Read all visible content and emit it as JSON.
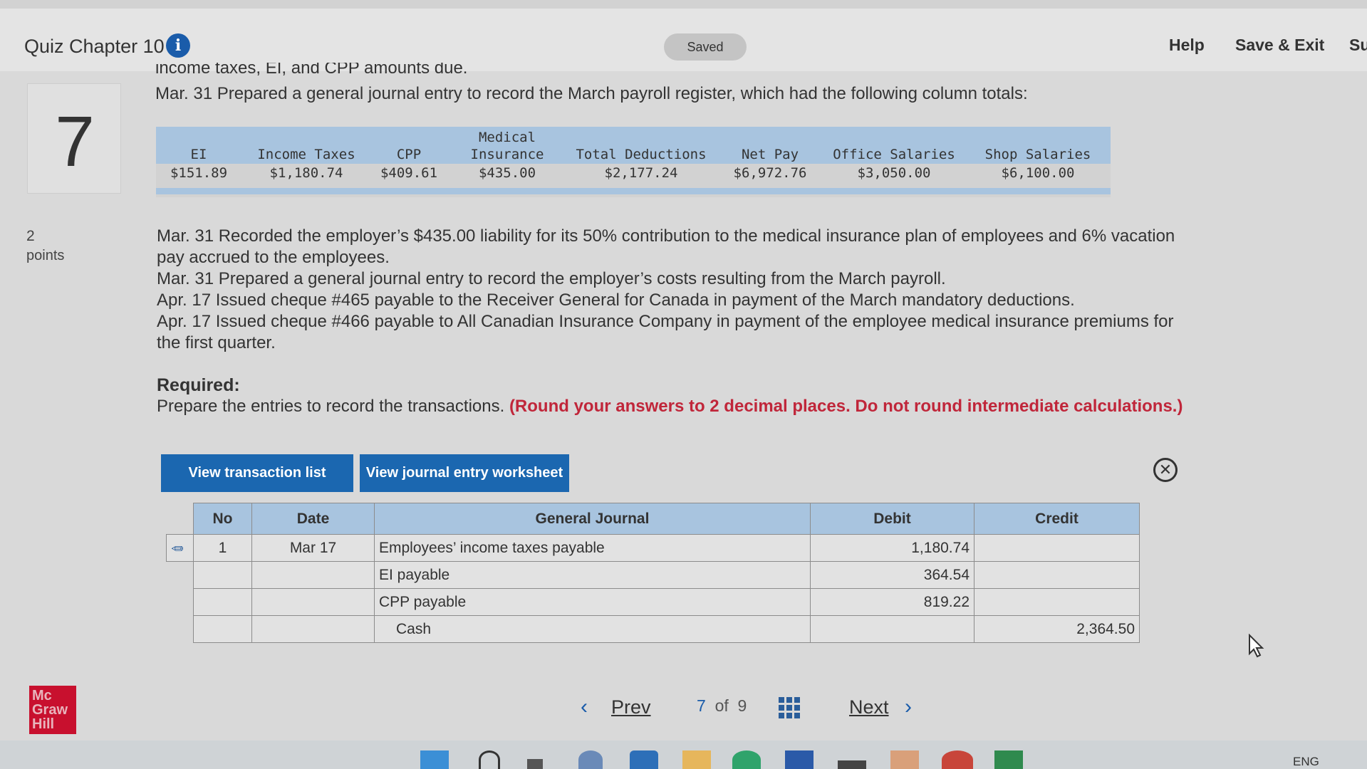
{
  "header": {
    "title": "Quiz Chapter 10",
    "status": "Saved",
    "help": "Help",
    "save_exit": "Save & Exit",
    "submit": "Su"
  },
  "question": {
    "number": "7",
    "points": "2",
    "points_label": "points",
    "cut_line": "income taxes, EI, and CPP amounts due.",
    "intro_line": "Mar. 31 Prepared a general journal entry to record the March payroll register, which had the following column totals:",
    "transactions": [
      "Mar. 31 Recorded the employer’s $435.00 liability for its 50% contribution to the medical insurance plan of employees and 6% vacation",
      "pay accrued to the employees.",
      "Mar. 31 Prepared a general journal entry to record the employer’s costs resulting from the March payroll.",
      "Apr. 17 Issued cheque #465 payable to the Receiver General for Canada in payment of the March mandatory deductions.",
      "Apr. 17 Issued cheque #466 payable to All Canadian Insurance Company in payment of the employee medical insurance premiums for",
      "the first quarter."
    ],
    "required_label": "Required:",
    "instruction": "Prepare the entries to record the transactions.",
    "instruction_red": "(Round your answers to 2 decimal places. Do not round intermediate calculations.)"
  },
  "payroll_register": {
    "headers": [
      {
        "top": "",
        "bottom": "EI"
      },
      {
        "top": "",
        "bottom": "Income Taxes"
      },
      {
        "top": "",
        "bottom": "CPP"
      },
      {
        "top": "Medical",
        "bottom": "Insurance"
      },
      {
        "top": "",
        "bottom": "Total Deductions"
      },
      {
        "top": "",
        "bottom": "Net Pay"
      },
      {
        "top": "",
        "bottom": "Office Salaries"
      },
      {
        "top": "",
        "bottom": "Shop Salaries"
      }
    ],
    "values": [
      "$151.89",
      "$1,180.74",
      "$409.61",
      "$435.00",
      "$2,177.24",
      "$6,972.76",
      "$3,050.00",
      "$6,100.00"
    ]
  },
  "buttons": {
    "view_transaction_list": "View transaction list",
    "view_journal_worksheet": "View journal entry worksheet"
  },
  "journal": {
    "columns": [
      "No",
      "Date",
      "General Journal",
      "Debit",
      "Credit"
    ],
    "rows": [
      {
        "no": "1",
        "date": "Mar 17",
        "account": "Employees’ income taxes payable",
        "debit": "1,180.74",
        "credit": ""
      },
      {
        "no": "",
        "date": "",
        "account": "EI payable",
        "debit": "364.54",
        "credit": ""
      },
      {
        "no": "",
        "date": "",
        "account": "CPP payable",
        "debit": "819.22",
        "credit": ""
      },
      {
        "no": "",
        "date": "",
        "account": "Cash",
        "debit": "",
        "credit": "2,364.50"
      }
    ]
  },
  "footer": {
    "logo": [
      "Mc",
      "Graw",
      "Hill"
    ],
    "prev": "Prev",
    "current": "7",
    "of": "of",
    "total": "9",
    "next": "Next",
    "language": "ENG"
  },
  "icons": {
    "info": "info-icon",
    "close": "close-circle-icon",
    "edit": "pencil-icon",
    "grid": "grid-icon"
  },
  "colors": {
    "accent_blue": "#1b67b0",
    "table_header": "#a8c4df",
    "instruction_red": "#c0263a",
    "logo_red": "#c8102e"
  }
}
